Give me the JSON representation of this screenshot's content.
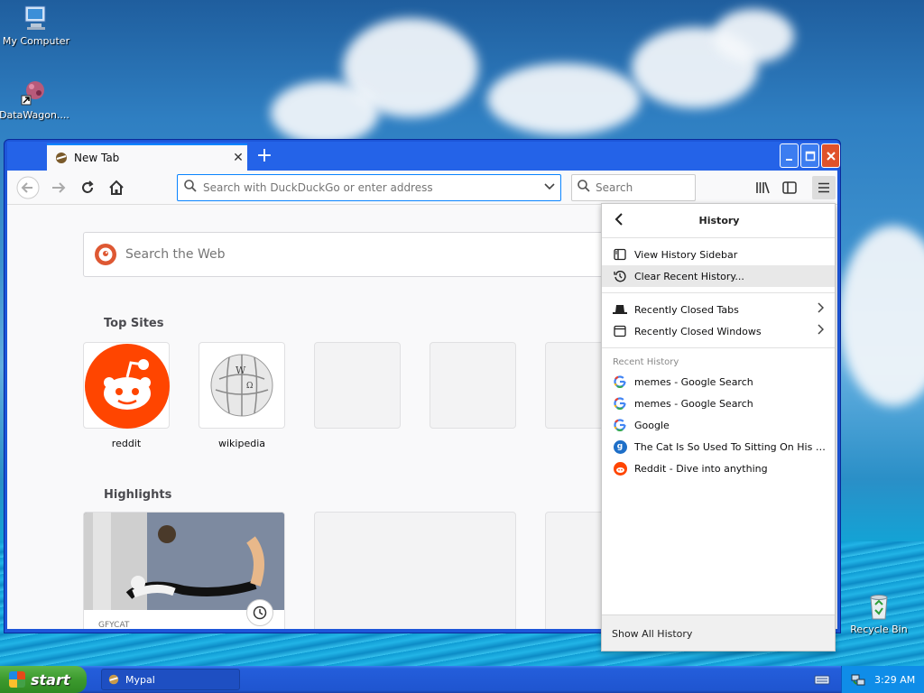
{
  "desktop": {
    "icons": [
      {
        "label": "My Computer",
        "icon": "computer-icon"
      },
      {
        "label": "DataWagon....",
        "icon": "datawagon-shortcut-icon"
      },
      {
        "label": "Recycle Bin",
        "icon": "recycle-bin-icon"
      }
    ]
  },
  "browser": {
    "tab_title": "New Tab",
    "tab_close": "✕",
    "new_tab": "+",
    "url_placeholder": "Search with DuckDuckGo or enter address",
    "search_placeholder": "Search",
    "web_search_placeholder": "Search the Web",
    "top_sites_title": "Top Sites",
    "top_sites": [
      {
        "label": "reddit"
      },
      {
        "label": "wikipedia"
      },
      {
        "label": ""
      },
      {
        "label": ""
      },
      {
        "label": ""
      }
    ],
    "highlights_title": "Highlights",
    "highlight_source": "GFYCAT"
  },
  "history_panel": {
    "title": "History",
    "view_sidebar": "View History Sidebar",
    "clear_recent": "Clear Recent History...",
    "recently_closed_tabs": "Recently Closed Tabs",
    "recently_closed_windows": "Recently Closed Windows",
    "recent_history_label": "Recent History",
    "items": [
      {
        "label": "memes - Google Search",
        "icon": "google-icon"
      },
      {
        "label": "memes - Google Search",
        "icon": "google-icon"
      },
      {
        "label": "Google",
        "icon": "google-icon"
      },
      {
        "label": "The Cat Is So Used To Sitting On His Back ...",
        "icon": "gfycat-icon"
      },
      {
        "label": "Reddit - Dive into anything",
        "icon": "reddit-icon"
      }
    ],
    "show_all": "Show All History"
  },
  "taskbar": {
    "start_label": "start",
    "task_label": "Mypal",
    "clock": "3:29 AM"
  }
}
